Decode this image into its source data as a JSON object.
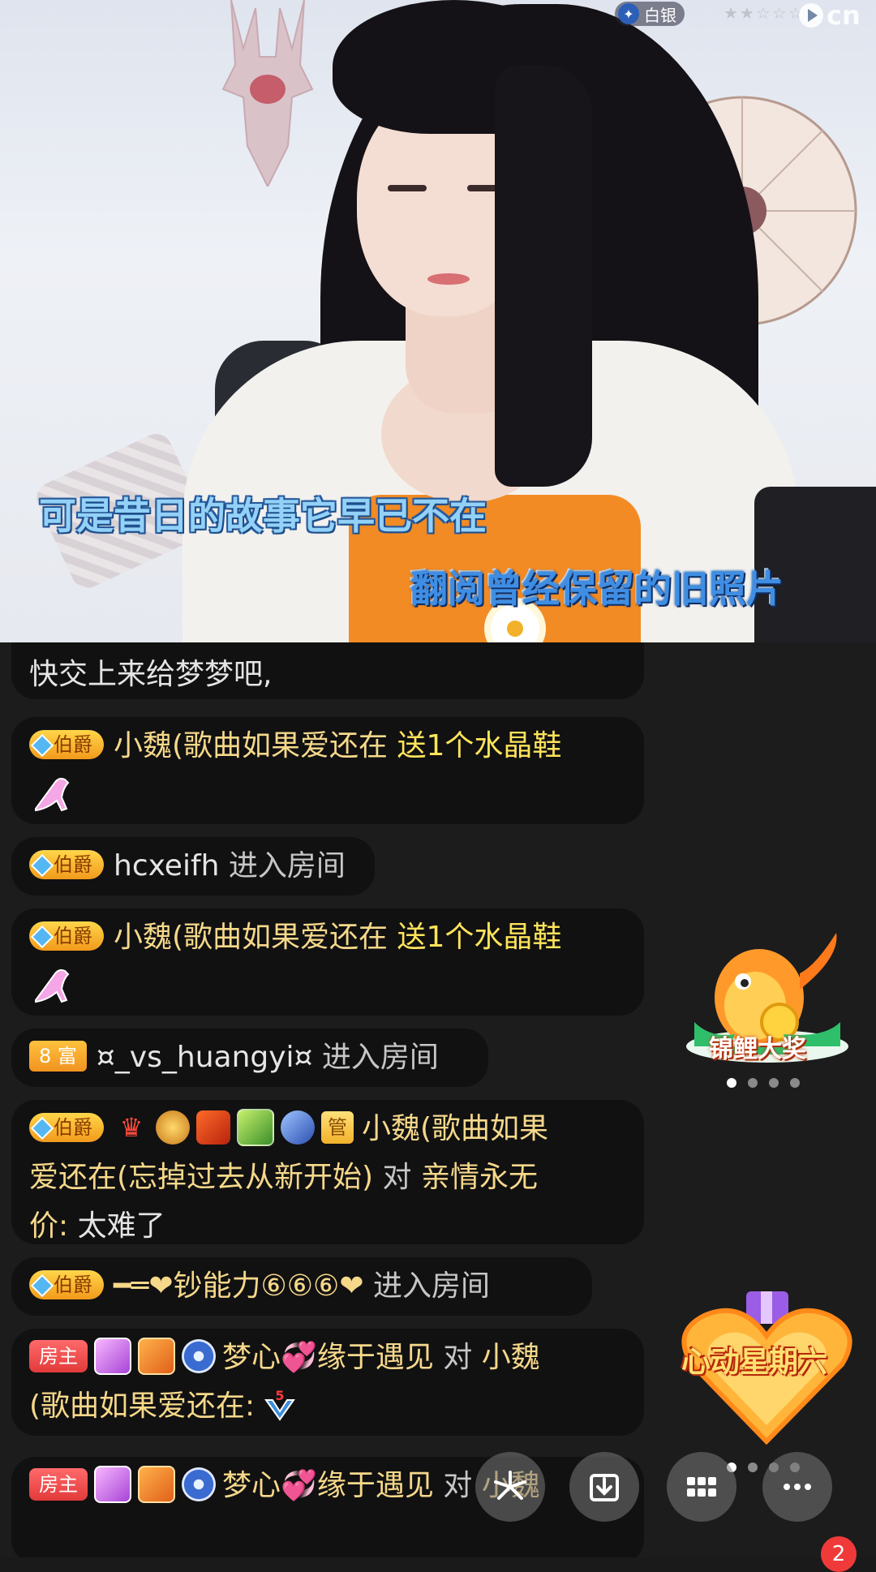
{
  "video": {
    "lyric_line1": "可是昔日的故事它早已不在",
    "lyric_line2": "翻阅曾经保留的旧照片",
    "rank_badge": "白银",
    "watermark": "cn"
  },
  "chat": {
    "messages": [
      {
        "text_tail": "快交上来给梦梦吧,"
      },
      {
        "badge": "伯爵",
        "user": "小魏(歌曲如果爱还在",
        "action": "送1个水晶鞋",
        "gift_icon": "crystal-shoe-icon"
      },
      {
        "badge": "伯爵",
        "user": "hcxeifh",
        "action": "进入房间"
      },
      {
        "badge": "伯爵",
        "user": "小魏(歌曲如果爱还在",
        "action": "送1个水晶鞋",
        "gift_icon": "crystal-shoe-icon"
      },
      {
        "badge": "8 富",
        "user": "¤_vs_huangyi¤",
        "action": "进入房间"
      },
      {
        "badge": "伯爵",
        "admin_badge": "管",
        "user": "小魏(歌曲如果",
        "user_cont": "爱还在(忘掉过去从新开始)",
        "to": "对",
        "target": "亲情永无",
        "target_cont": "价:",
        "text": "太难了"
      },
      {
        "badge": "伯爵",
        "user": "━═❤钞能力⑥⑥⑥❤",
        "action": "进入房间"
      },
      {
        "badge": "房主",
        "user": "梦心💞缘于遇见",
        "to": "对",
        "target": "小魏",
        "target_cont": "(歌曲如果爱还在:",
        "level": "5"
      },
      {
        "badge": "房主",
        "user": "梦心💞缘于遇见",
        "to": "对",
        "target": "小魏"
      }
    ]
  },
  "widgets": {
    "koi_label": "锦鲤大奖",
    "heart_label": "心动星期六"
  },
  "toolbar": {
    "notification_count": "2"
  },
  "colors": {
    "username": "#f6d88a",
    "gift_text": "#ffe45a",
    "bubble_bg": "#111112",
    "badge_gold": "#f29a1b",
    "badge_host": "#e23a3a"
  }
}
